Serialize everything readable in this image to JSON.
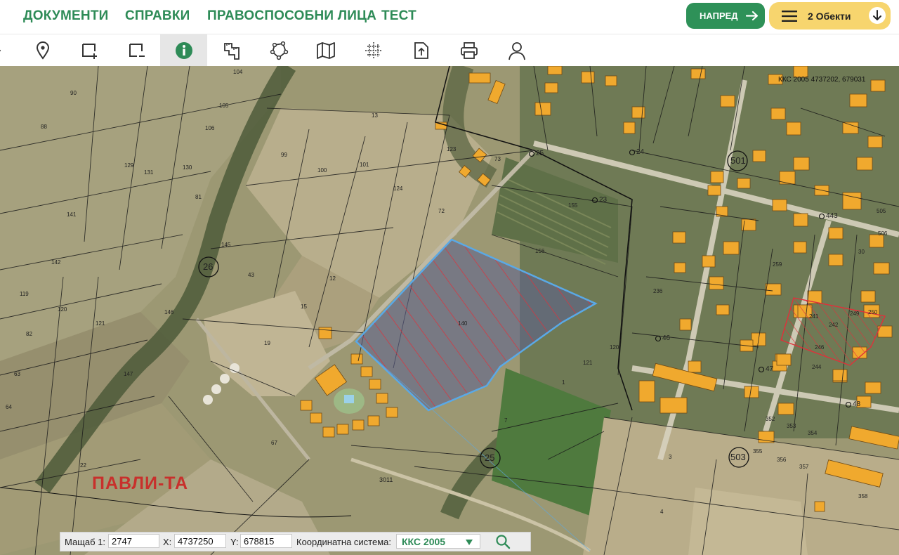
{
  "nav": {
    "links": [
      "ДОКУМЕНТИ",
      "СПРАВКИ",
      "ПРАВОСПОСОБНИ ЛИЦА",
      "ТЕСТ"
    ],
    "next_label": "НАПРЕД",
    "objects_label": "2 Обекти"
  },
  "toolbar": {
    "tools": [
      "expand-arrow-icon",
      "location-pin-icon",
      "draw-polygon-plus-icon",
      "draw-polygon-minus-icon",
      "info-icon",
      "measure-area-icon",
      "polygon-nodes-icon",
      "map-icon",
      "grid-crosshair-icon",
      "export-document-icon",
      "print-icon",
      "user-icon"
    ],
    "active_tool": "info-icon"
  },
  "map": {
    "crs_readout": "ККС 2005 4737202, 679031",
    "place_label": "ПАВЛИ-ТА",
    "block_numbers": [
      "26",
      "25",
      "503",
      "501"
    ],
    "point_labels": [
      "25",
      "24",
      "23",
      "443",
      "46",
      "47",
      "48",
      "3011"
    ],
    "parcel_numbers": [
      "104",
      "90",
      "105",
      "106",
      "88",
      "129",
      "131",
      "130",
      "141",
      "81",
      "145",
      "142",
      "119",
      "120",
      "121",
      "82",
      "63",
      "64",
      "147",
      "99",
      "100",
      "101",
      "124",
      "72",
      "73",
      "123",
      "13",
      "156",
      "155",
      "140",
      "12",
      "15",
      "19",
      "43",
      "146",
      "67",
      "22",
      "1",
      "7",
      "120",
      "121",
      "4",
      "3",
      "250",
      "30",
      "505",
      "506",
      "236",
      "241",
      "242",
      "244",
      "246",
      "249",
      "259",
      "352",
      "353",
      "354",
      "355",
      "356",
      "357",
      "358",
      "359"
    ],
    "selection_color": "#5aa9e6",
    "hatch_color": "#e0303a",
    "label_color": "#c8302c"
  },
  "coords": {
    "scale_label": "Мащаб 1:",
    "scale_value": "2747",
    "x_label": "X:",
    "x_value": "4737250",
    "y_label": "Y:",
    "y_value": "678815",
    "crs_label": "Координатна система:",
    "crs_value": "ККС 2005"
  },
  "colors": {
    "accent_green": "#2e8b57",
    "button_green": "#2e9158",
    "button_yellow": "#f7d56e"
  }
}
